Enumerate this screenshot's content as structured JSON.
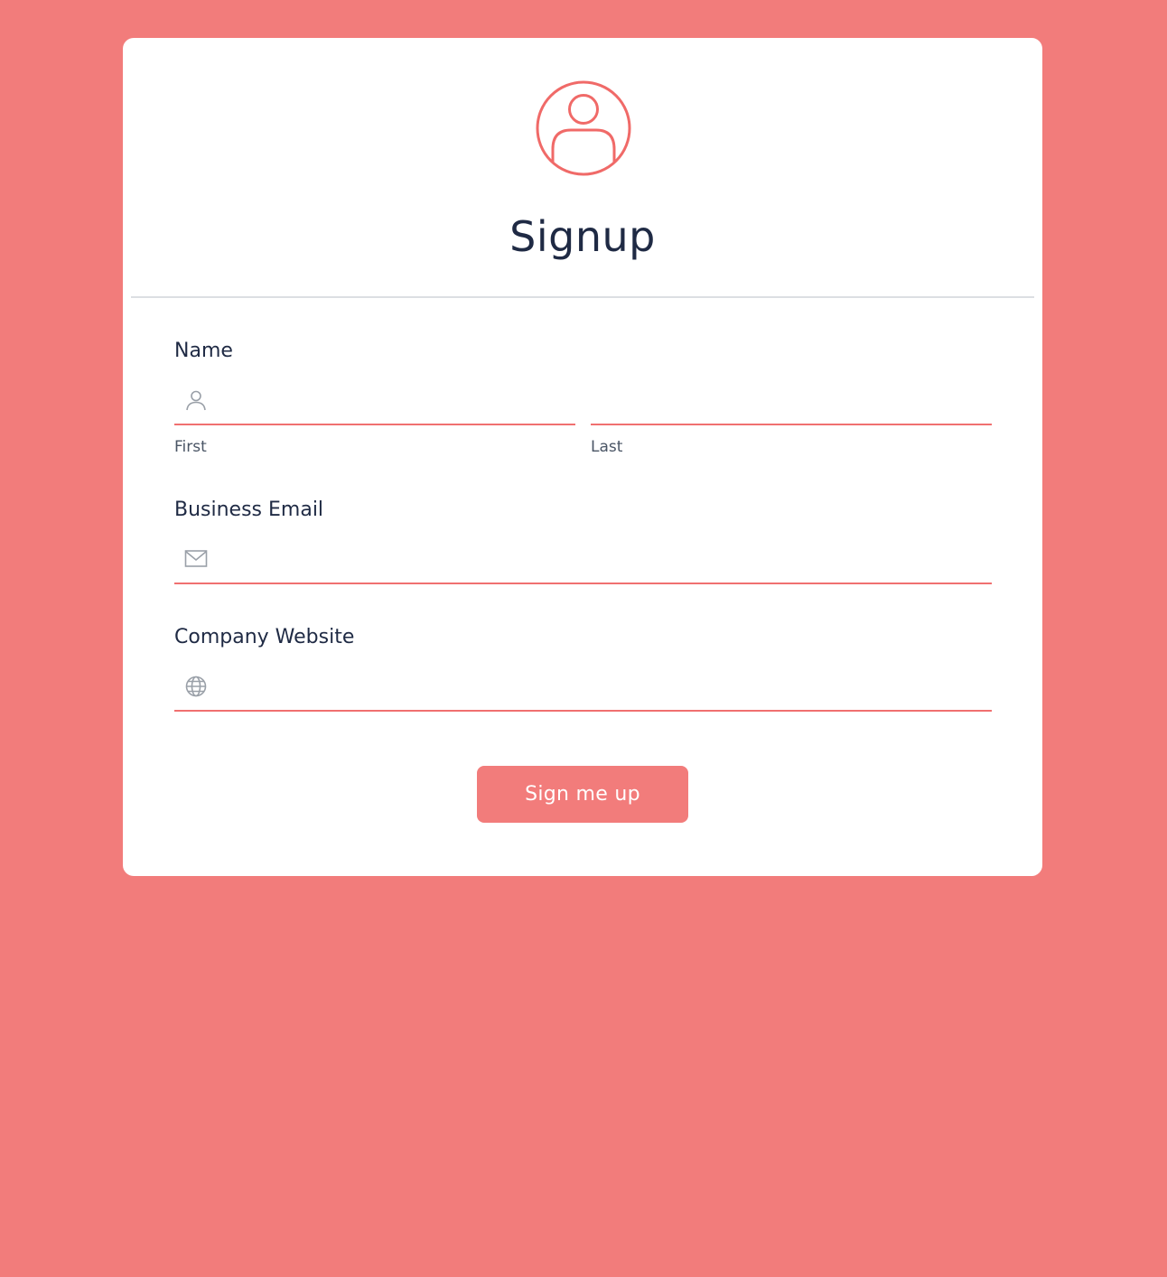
{
  "form": {
    "title": "Signup",
    "name_label": "Name",
    "first_value": "",
    "first_sublabel": "First",
    "last_value": "",
    "last_sublabel": "Last",
    "email_label": "Business Email",
    "email_value": "",
    "website_label": "Company Website",
    "website_value": "",
    "submit_label": "Sign me up"
  },
  "icons": {
    "header": "user-circle-icon",
    "name": "user-icon",
    "email": "envelope-icon",
    "website": "globe-icon"
  },
  "colors": {
    "background": "#f27c7b",
    "card": "#ffffff",
    "accent": "#f07070",
    "text": "#1f2a44",
    "icon_gray": "#9aa0a8"
  }
}
